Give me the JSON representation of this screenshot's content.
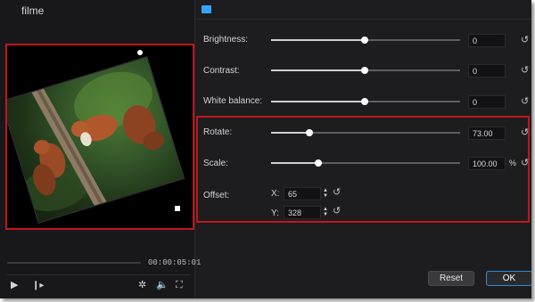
{
  "window": {
    "title": "filme"
  },
  "preview": {
    "time": "00:00:05:01"
  },
  "playback_controls": {
    "play_icon": "play-icon",
    "next_frame_icon": "next-frame-icon",
    "settings_icon": "settings-icon",
    "volume_icon": "volume-icon",
    "fullscreen_icon": "fullscreen-icon"
  },
  "adjustments": {
    "brightness": {
      "label": "Brightness:",
      "value": "0",
      "slider_fraction": 0.5
    },
    "contrast": {
      "label": "Contrast:",
      "value": "0",
      "slider_fraction": 0.5
    },
    "white_balance": {
      "label": "White balance:",
      "value": "0",
      "slider_fraction": 0.5
    }
  },
  "transform": {
    "rotate": {
      "label": "Rotate:",
      "value": "73.00",
      "slider_fraction": 0.2
    },
    "scale": {
      "label": "Scale:",
      "value": "100.00",
      "unit": "%",
      "slider_fraction": 0.25
    },
    "offset": {
      "label": "Offset:",
      "x_label": "X:",
      "x_value": "65",
      "y_label": "Y:",
      "y_value": "328"
    }
  },
  "buttons": {
    "reset": "Reset",
    "ok": "OK"
  },
  "colors": {
    "highlight_red": "#c0161d",
    "accent_blue": "#2f8bdc"
  }
}
